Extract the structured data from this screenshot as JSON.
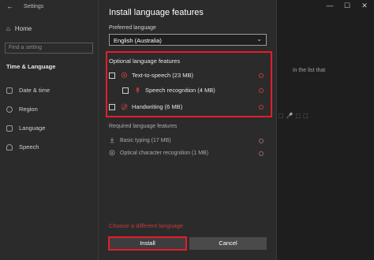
{
  "settings": {
    "title": "Settings",
    "back_icon": "back-arrow-icon",
    "minimize": "—",
    "maximize": "☐",
    "close": "✕",
    "home_label": "Home",
    "search_placeholder": "Find a setting",
    "section": "Time & Language",
    "nav": [
      {
        "label": "Date & time",
        "icon": "calendar-icon"
      },
      {
        "label": "Region",
        "icon": "globe-icon"
      },
      {
        "label": "Language",
        "icon": "language-icon"
      },
      {
        "label": "Speech",
        "icon": "microphone-icon"
      }
    ],
    "hint_text": "in the list that"
  },
  "dialog": {
    "title": "Install language features",
    "preferred_label": "Preferred language",
    "preferred_value": "English (Australia)",
    "optional_title": "Optional language features",
    "optional": [
      {
        "label": "Text-to-speech (23 MB)",
        "icon": "text-to-speech-icon"
      },
      {
        "label": "Speech recognition (4 MB)",
        "icon": "microphone-icon"
      },
      {
        "label": "Handwriting (6 MB)",
        "icon": "pen-icon"
      }
    ],
    "required_title": "Required language features",
    "required": [
      {
        "label": "Basic typing (17 MB)",
        "icon": "typing-icon"
      },
      {
        "label": "Optical character recognition (1 MB)",
        "icon": "ocr-icon"
      }
    ],
    "choose_link": "Choose a different language",
    "install_label": "Install",
    "cancel_label": "Cancel"
  },
  "colors": {
    "accent": "#e51d2a",
    "dialog_bg": "#2b2b2b",
    "page_bg": "#000000"
  }
}
